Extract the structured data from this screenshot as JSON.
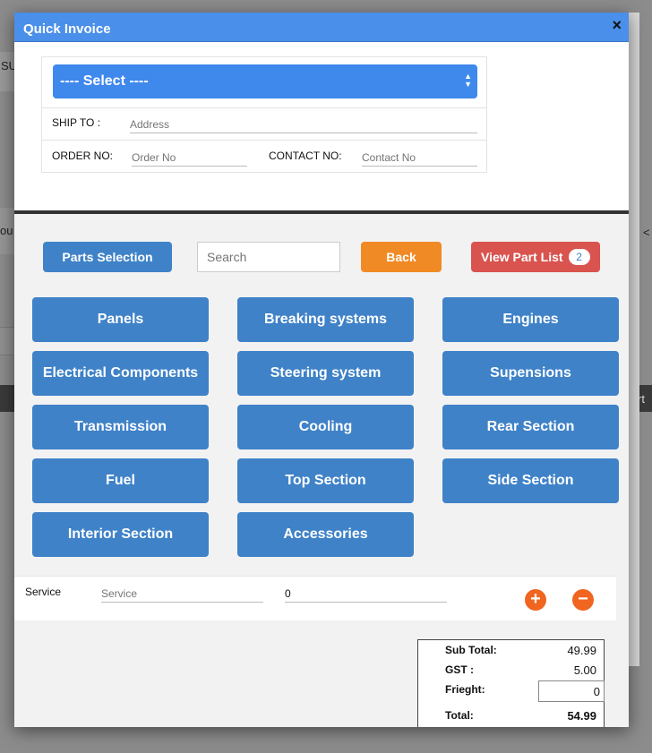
{
  "backdrop": {
    "frag1": "SU",
    "frag2": "ou",
    "frag3": "rt",
    "frag4": "<"
  },
  "modal": {
    "title": "Quick Invoice",
    "close_symbol": "×"
  },
  "customer": {
    "select_value": "---- Select ----",
    "ship_to_label": "SHIP TO :",
    "address_placeholder": "Address",
    "order_no_label": "ORDER NO:",
    "order_no_placeholder": "Order No",
    "contact_no_label": "CONTACT NO:",
    "contact_no_placeholder": "Contact No"
  },
  "toolbar": {
    "parts_selection": "Parts Selection",
    "search_placeholder": "Search",
    "back": "Back",
    "view_part_list": "View Part List",
    "part_count": "2"
  },
  "categories": [
    "Panels",
    "Breaking systems",
    "Engines",
    "Electrical Components",
    "Steering system",
    "Supensions",
    "Transmission",
    "Cooling",
    "Rear Section",
    "Fuel",
    "Top Section",
    "Side Section",
    "Interior Section",
    "Accessories"
  ],
  "service": {
    "label": "Service",
    "placeholder": "Service",
    "qty_value": "0",
    "add_symbol": "+",
    "remove_symbol": "−"
  },
  "totals": {
    "subtotal_label": "Sub Total:",
    "subtotal_value": "49.99",
    "gst_label": "GST :",
    "gst_value": "5.00",
    "freight_label": "Frieght:",
    "freight_value": "0",
    "total_label": "Total:",
    "total_value": "54.99"
  },
  "colors": {
    "title_bar": "#4a8fea",
    "primary_button": "#3f82c8",
    "back_button": "#f08a25",
    "view_button": "#d9534f",
    "circle_button": "#f0651f"
  }
}
